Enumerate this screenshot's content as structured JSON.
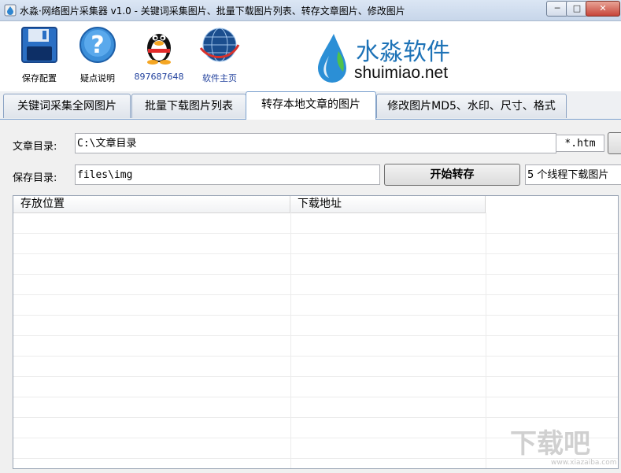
{
  "window": {
    "title": "水淼·网络图片采集器 v1.0 - 关键词采集图片、批量下载图片列表、转存文章图片、修改图片",
    "controls": {
      "minimize": "─",
      "maximize": "□",
      "close": "✕"
    }
  },
  "toolbar": {
    "items": [
      {
        "label": "保存配置",
        "icon": "save-disk-icon"
      },
      {
        "label": "疑点说明",
        "icon": "help-icon"
      },
      {
        "label": "897687648",
        "icon": "qq-penguin-icon"
      },
      {
        "label": "软件主页",
        "icon": "globe-icon"
      }
    ]
  },
  "logo": {
    "cn": "水淼软件",
    "en": "shuimiao.net"
  },
  "tabs": [
    {
      "label": "关键词采集全网图片",
      "active": false
    },
    {
      "label": "批量下载图片列表",
      "active": false
    },
    {
      "label": "转存本地文章的图片",
      "active": true
    },
    {
      "label": "修改图片MD5、水印、尺寸、格式",
      "active": false
    }
  ],
  "form": {
    "article_dir_label": "文章目录:",
    "article_dir_value": "C:\\文章目录",
    "ext_value": "*.htm",
    "save_dir_label": "保存目录:",
    "save_dir_value": "files\\img",
    "start_button": "开始转存",
    "threads_value": "5 个线程下载图片"
  },
  "grid": {
    "columns": [
      "存放位置",
      "下载地址"
    ]
  },
  "watermark": {
    "text": "下载吧",
    "sub": "www.xiazaiba.com"
  },
  "colors": {
    "accent": "#1e73b7",
    "tab_border": "#7da2ce",
    "title_bar": "#c7d6ea"
  }
}
